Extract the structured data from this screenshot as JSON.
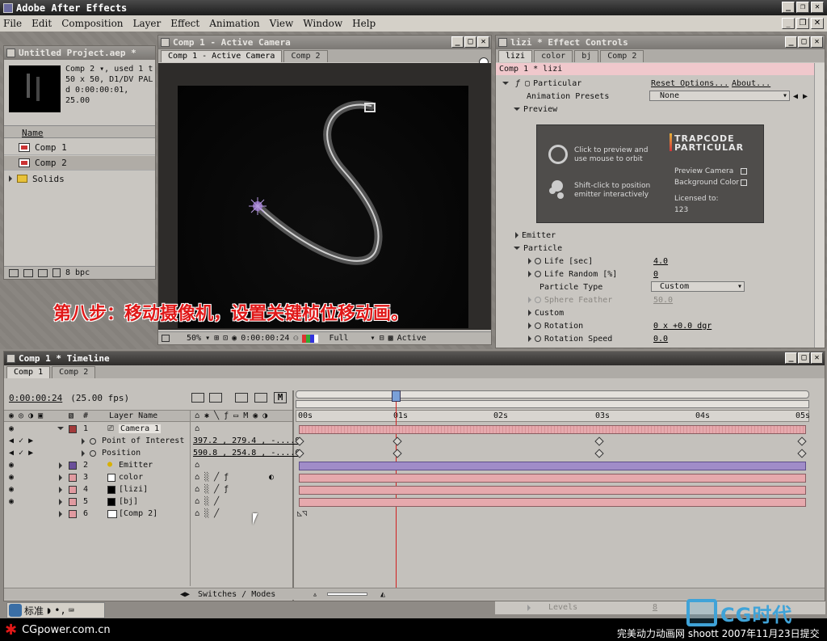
{
  "app": {
    "title": "Adobe After Effects"
  },
  "menu": [
    "File",
    "Edit",
    "Composition",
    "Layer",
    "Effect",
    "Animation",
    "View",
    "Window",
    "Help"
  ],
  "project": {
    "title": "Untitled Project.aep *",
    "info": [
      "Comp 2 ▾, used 1 t",
      "50 x 50, D1/DV PAL",
      "d 0:00:00:01, 25.00"
    ],
    "col_name": "Name",
    "items": [
      {
        "label": "Comp 1",
        "icon": "comp-icon"
      },
      {
        "label": "Comp 2",
        "icon": "comp-icon"
      },
      {
        "label": "Solids",
        "icon": "folder-icon"
      }
    ],
    "bpc": "8 bpc"
  },
  "comp": {
    "title": "Comp 1 - Active Camera",
    "tabs": [
      "Comp 1 - Active Camera",
      "Comp 2"
    ],
    "zoom": "50%",
    "timecode": "0:00:00:24",
    "resolution": "Full",
    "view": "Active"
  },
  "effect": {
    "title": "lizi * Effect Controls",
    "tabs": [
      "lizi",
      "color",
      "bj",
      "Comp 2"
    ],
    "header": "Comp 1 * lizi",
    "particular": "Particular",
    "reset": "Reset Options...",
    "about": "About...",
    "anim_presets_label": "Animation Presets",
    "anim_presets_value": "None",
    "preview": "Preview",
    "preview_box": {
      "hint1": "Click to preview and use mouse to orbit",
      "hint2": "Shift-click to position emitter interactively",
      "brand1": "TRAPCODE",
      "brand2": "PARTICULAR",
      "preview_camera": "Preview Camera",
      "background_color": "Background Color",
      "licensed": "Licensed to:",
      "license_num": "123"
    },
    "emitter": "Emitter",
    "particle": "Particle",
    "props": [
      {
        "label": "Life [sec]",
        "value": "4.0",
        "dim": false
      },
      {
        "label": "Life Random [%]",
        "value": "0",
        "dim": false
      },
      {
        "label": "Particle Type",
        "value": "Custom",
        "dropdown": true
      },
      {
        "label": "Sphere Feather",
        "value": "50.0",
        "dim": true
      },
      {
        "label": "Custom",
        "value": "",
        "dim": false
      },
      {
        "label": "Rotation",
        "value": "0 x +0.0 dgr",
        "dim": false
      },
      {
        "label": "Rotation Speed",
        "value": "0.0",
        "dim": false
      }
    ],
    "levels_label": "Levels",
    "levels_value": "8"
  },
  "timeline": {
    "title": "Comp 1 * Timeline",
    "tabs": [
      "Comp 1",
      "Comp 2"
    ],
    "timecode": "0:00:00:24",
    "fps": "(25.00 fps)",
    "col_num": "#",
    "col_layer": "Layer Name",
    "ruler": [
      "00s",
      "01s",
      "02s",
      "03s",
      "04s",
      "05s"
    ],
    "layers": [
      {
        "num": "1",
        "name": "Camera 1",
        "color": "#a23a3a",
        "open": true
      },
      {
        "num": "2",
        "name": "Emitter",
        "color": "#6a4f9a"
      },
      {
        "num": "3",
        "name": "color",
        "color": "#e09aa0"
      },
      {
        "num": "4",
        "name": "[lizi]",
        "color": "#e09aa0"
      },
      {
        "num": "5",
        "name": "[bj]",
        "color": "#e09aa0"
      },
      {
        "num": "6",
        "name": "[Comp 2]",
        "color": "#e09aa0"
      }
    ],
    "cam_props": [
      {
        "label": "Point of Interest",
        "value": "397.2 , 279.4 , -....9"
      },
      {
        "label": "Position",
        "value": "590.8 , 254.8 , -....6"
      }
    ],
    "switches": "Switches / Modes"
  },
  "caption": "第八步：移动摄像机，设置关键桢位移动画。",
  "taskbar": {
    "ime": "标准",
    "logo": "CGpower.com.cn",
    "credit": "完美动力动画网 shoott 2007年11月23日提交",
    "brand": "CG时代"
  },
  "colors": {
    "bar_red": "#e6a9ad",
    "bar_purple": "#a08cc8",
    "cti": "#d21f1f"
  }
}
